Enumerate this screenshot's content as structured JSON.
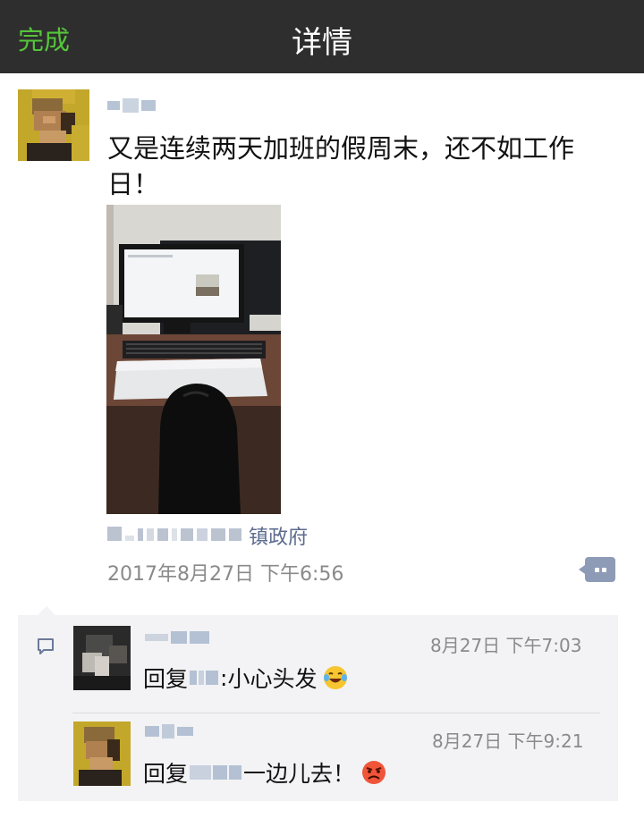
{
  "nav": {
    "done_label": "完成",
    "title": "详情"
  },
  "post": {
    "author_name_obscured": true,
    "text": "又是连续两天加班的假周末，还不如工作日！",
    "location_suffix": "镇政府",
    "timestamp": "2017年8月27日 下午6:56"
  },
  "comments": [
    {
      "time": "8月27日 下午7:03",
      "reply_prefix": "回复",
      "separator": ":",
      "text": " 小心头发",
      "emoji": "laugh-cry-emoji"
    },
    {
      "time": "8月27日 下午9:21",
      "reply_prefix": "回复",
      "separator": "",
      "text": " 一边儿去！",
      "emoji": "angry-face-emoji"
    }
  ],
  "colors": {
    "nav_bg": "#2e2e2e",
    "accent_green": "#55c53b",
    "link_blue": "#5d6b8f",
    "meta_gray": "#8a8a8a",
    "comment_bg": "#f3f3f5"
  }
}
